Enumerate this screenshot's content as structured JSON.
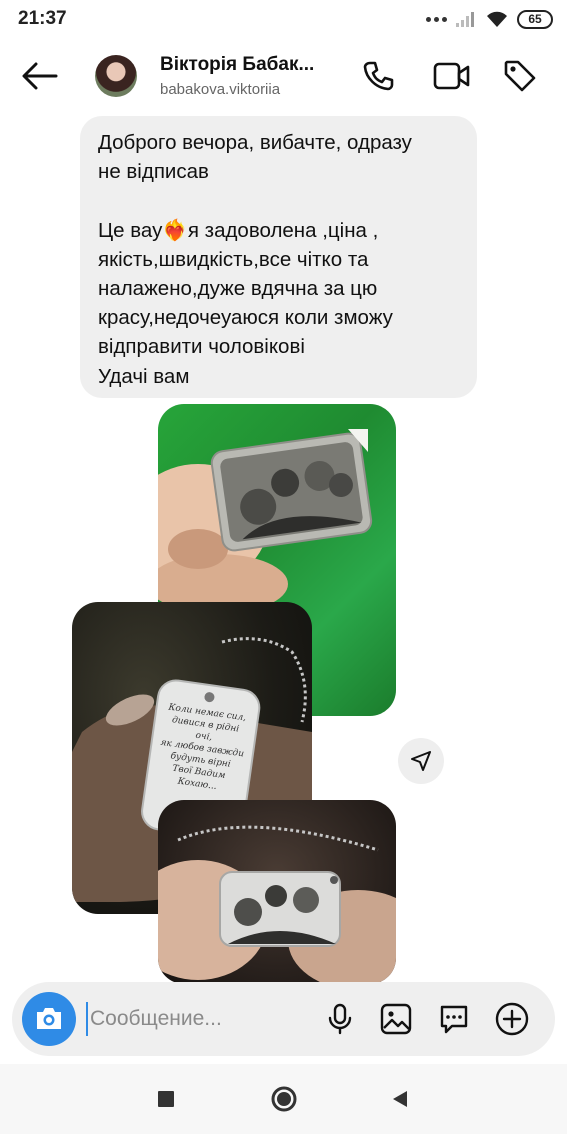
{
  "status_bar": {
    "time": "21:37",
    "battery": "65",
    "icons": [
      "more-dots-icon",
      "signal-icon",
      "wifi-icon",
      "battery-icon"
    ]
  },
  "header": {
    "display_name": "Вікторія Бабак...",
    "username": "babakova.viktoriia",
    "actions": [
      "phone-call-icon",
      "video-call-icon",
      "tag-icon"
    ]
  },
  "message": {
    "text": "Доброго вечора, вибачте, одразу\nне відписав\n\nЦе вау❤️‍🔥я задоволена ,ціна ,\nякість,швидкість,все чітко та\nналажено,дуже вдячна за цю\nкрасу,недочеуаюся коли зможу\nвідправити чоловікові\nУдачі вам"
  },
  "photos": [
    {
      "description_icon": "engraved-family-pendant-photo"
    },
    {
      "description_icon": "engraved-poem-dogtag-photo"
    },
    {
      "description_icon": "engraved-family-dogtag-photo"
    }
  ],
  "photo2_engraving": "Коли немає сил,\nдивися в рідні\nочі,\nяк любов завжди\nбудуть вірні\nТвої Вадим\nКохаю...",
  "composer": {
    "placeholder": "Сообщение...",
    "value": "",
    "icons": [
      "camera-icon",
      "microphone-icon",
      "gallery-icon",
      "chat-sticker-icon",
      "add-icon"
    ]
  },
  "nav": [
    "recents-square-icon",
    "home-circle-icon",
    "back-triangle-icon"
  ],
  "colors": {
    "accent": "#2f8be6",
    "bubble": "#efefef",
    "text": "#111111",
    "secondary_text": "#666666"
  }
}
